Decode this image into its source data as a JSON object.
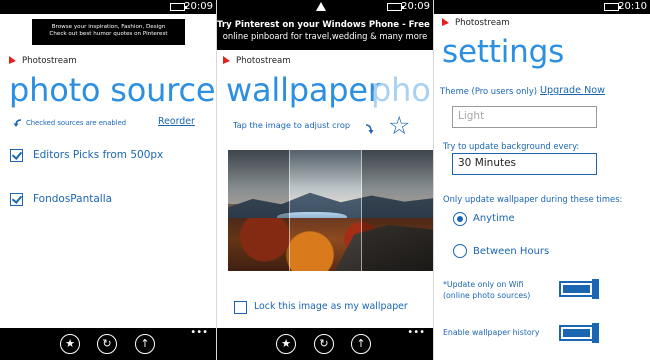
{
  "status": {
    "s1_time": "20:09",
    "s2_time": "20:09",
    "s3_time": "20:10"
  },
  "brand": "Photostream",
  "screen1": {
    "ad_line1": "Browse your inspiration, Fashion, Design",
    "ad_line2": "Check out best humor quotes on Pinterest",
    "title": "photo sources",
    "note": "Checked sources are enabled",
    "reorder": "Reorder",
    "sources": [
      {
        "label": "Editors Picks from 500px",
        "checked": true
      },
      {
        "label": "FondosPantalla",
        "checked": true
      }
    ]
  },
  "screen2": {
    "ad_line1": "Try Pinterest on your Windows Phone - Free App",
    "ad_line2": "online pinboard for travel,wedding & many more",
    "title": "wallpaper",
    "title_next": "pho",
    "crop_hint": "Tap the image to adjust crop",
    "lock_label": "Lock this image as my wallpaper",
    "lock_checked": false
  },
  "screen3": {
    "title": "settings",
    "theme_label": "Theme (Pro users only)",
    "upgrade": "Upgrade Now",
    "theme_value": "Light",
    "update_label": "Try to update background every:",
    "update_value": "30 Minutes",
    "times_label": "Only update wallpaper during these times:",
    "radio_anytime": "Anytime",
    "radio_between": "Between Hours",
    "wifi_label_1": "*Update only on Wifi",
    "wifi_label_2": "(online photo sources)",
    "history_label": "Enable wallpaper history",
    "selected_radio": "Anytime"
  },
  "appbar": {
    "dots": "•••",
    "buttons": [
      "star-icon",
      "refresh-icon",
      "upload-icon"
    ]
  },
  "colors": {
    "accent": "#1a66b3",
    "title": "#2d8fe0",
    "brand_red": "#e2231a"
  }
}
